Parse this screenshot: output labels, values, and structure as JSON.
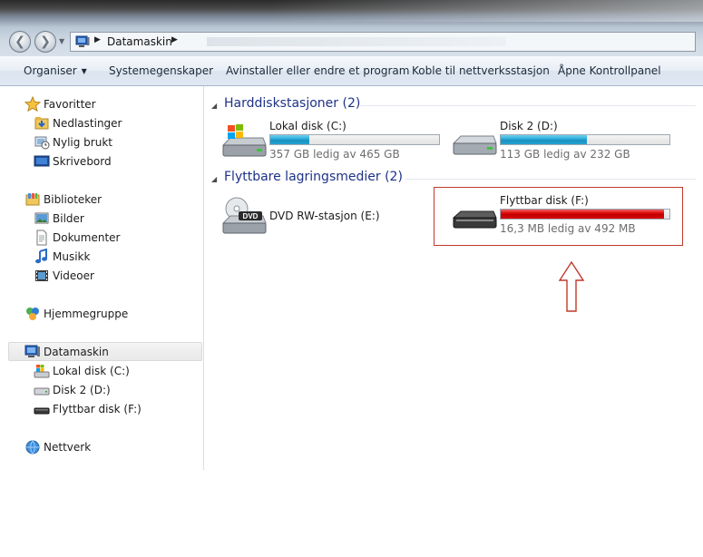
{
  "address": {
    "crumb": "Datamaskin"
  },
  "toolbar": {
    "organise": "Organiser",
    "system_props": "Systemegenskaper",
    "uninstall": "Avinstaller eller endre et program",
    "map_drive": "Koble til nettverksstasjon",
    "control_panel": "Åpne Kontrollpanel"
  },
  "nav": {
    "favorites": "Favoritter",
    "downloads": "Nedlastinger",
    "recent": "Nylig brukt",
    "desktop": "Skrivebord",
    "libraries": "Biblioteker",
    "pictures": "Bilder",
    "documents": "Dokumenter",
    "music": "Musikk",
    "videos": "Videoer",
    "homegroup": "Hjemmegruppe",
    "computer": "Datamaskin",
    "drive_c": "Lokal disk (C:)",
    "drive_d": "Disk 2 (D:)",
    "drive_f": "Flyttbar disk (F:)",
    "network": "Nettverk"
  },
  "groups": {
    "hard_disks": "Harddiskstasjoner (2)",
    "removable": "Flyttbare lagringsmedier (2)"
  },
  "drives": {
    "c": {
      "name": "Lokal disk (C:)",
      "free": "357 GB ledig av 465 GB",
      "used_fraction": 0.23
    },
    "d": {
      "name": "Disk 2 (D:)",
      "free": "113 GB ledig av 232 GB",
      "used_fraction": 0.51
    },
    "e": {
      "name": "DVD RW-stasjon (E:)",
      "dvd_label": "DVD"
    },
    "f": {
      "name": "Flyttbar disk (F:)",
      "free": "16,3 MB ledig av 492 MB",
      "used_fraction": 0.967
    }
  },
  "colors": {
    "bar_normal": "#26a8d6",
    "bar_full": "#d90000",
    "annotation": "#c0392b",
    "group_title": "#1e3287"
  },
  "icons": {
    "favorites": "star-icon",
    "downloads": "downloads-folder-icon",
    "recent": "recent-places-icon",
    "desktop": "desktop-icon",
    "libraries": "libraries-icon",
    "pictures": "pictures-icon",
    "documents": "documents-icon",
    "music": "music-icon",
    "videos": "videos-icon",
    "homegroup": "homegroup-icon",
    "computer": "computer-icon",
    "network": "network-icon"
  }
}
